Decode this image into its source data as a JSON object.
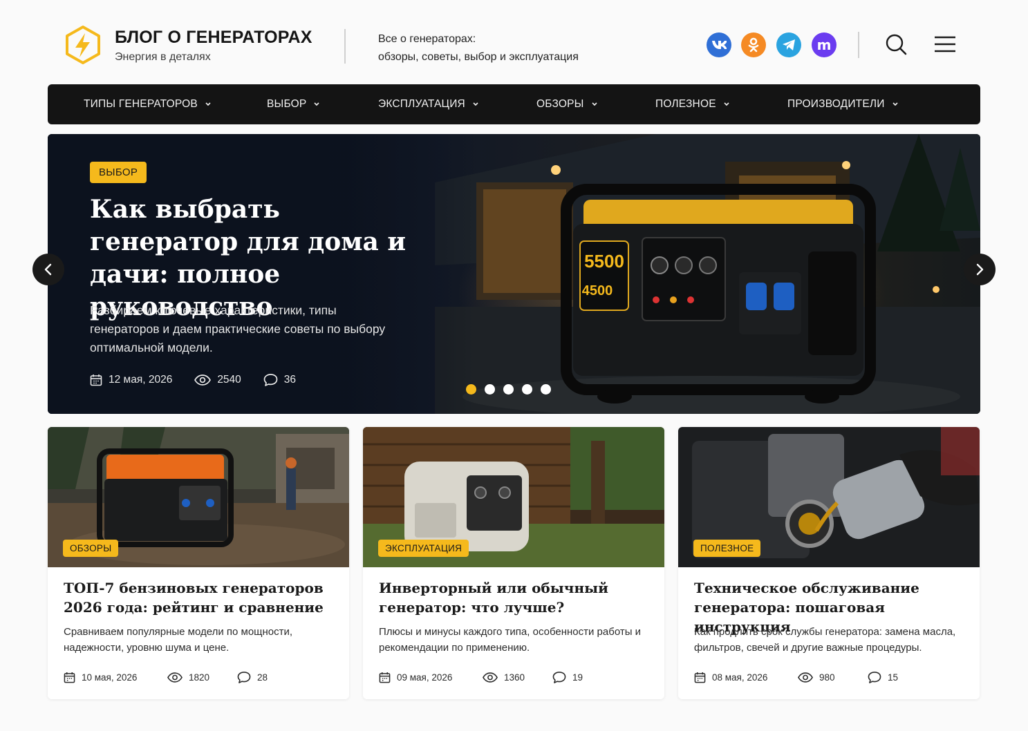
{
  "header": {
    "logo_title": "БЛОГ О ГЕНЕРАТОРАХ",
    "logo_subtitle": "Энергия в деталях",
    "tagline_line1": "Все о генераторах:",
    "tagline_line2": "обзоры, советы, выбор и эксплуатация",
    "social": [
      {
        "name": "vk",
        "label": "vk",
        "color": "#2f6fd6"
      },
      {
        "name": "odnoklassniki",
        "label": "ok",
        "color": "#f58a24"
      },
      {
        "name": "telegram",
        "label": "tg",
        "color": "#2aa3e0"
      },
      {
        "name": "max",
        "label": "m",
        "color": "#6b3cf0"
      }
    ],
    "accent_color": "#f5b91c"
  },
  "nav": {
    "items": [
      {
        "label": "ТИПЫ ГЕНЕРАТОРОВ"
      },
      {
        "label": "ВЫБОР"
      },
      {
        "label": "ЭКСПЛУАТАЦИЯ"
      },
      {
        "label": "ОБЗОРЫ"
      },
      {
        "label": "ПОЛЕЗНОЕ"
      },
      {
        "label": "ПРОИЗВОДИТЕЛИ"
      }
    ]
  },
  "hero": {
    "badge": "ВЫБОР",
    "title": "Как выбрать генератор для дома и дачи: полное руководство",
    "description": "Разбираем ключевые характеристики, типы генераторов и даем практические советы по выбору оптимальной модели.",
    "date": "12 мая, 2026",
    "views": "2540",
    "comments": "36",
    "slides_total": 5,
    "active_slide": 1,
    "image_text_line1": "5500",
    "image_text_line2": "4500"
  },
  "cards": [
    {
      "badge": "ОБЗОРЫ",
      "title": "ТОП-7 бензиновых генераторов 2026 года: рейтинг и сравнение",
      "description": "Сравниваем популярные модели по мощности, надежности, уровню шума и цене.",
      "date": "10 мая, 2026",
      "views": "1820",
      "comments": "28"
    },
    {
      "badge": "ЭКСПЛУАТАЦИЯ",
      "title": "Инверторный или обычный генератор: что лучше?",
      "description": "Плюсы и минусы каждого типа, особенности работы и рекомендации по применению.",
      "date": "09 мая, 2026",
      "views": "1360",
      "comments": "19"
    },
    {
      "badge": "ПОЛЕЗНОЕ",
      "title": "Техническое обслуживание генератора: пошаговая инструкция",
      "description": "Как продлить срок службы генератора: замена масла, фильтров, свечей и другие важные процедуры.",
      "date": "08 мая, 2026",
      "views": "980",
      "comments": "15"
    }
  ]
}
